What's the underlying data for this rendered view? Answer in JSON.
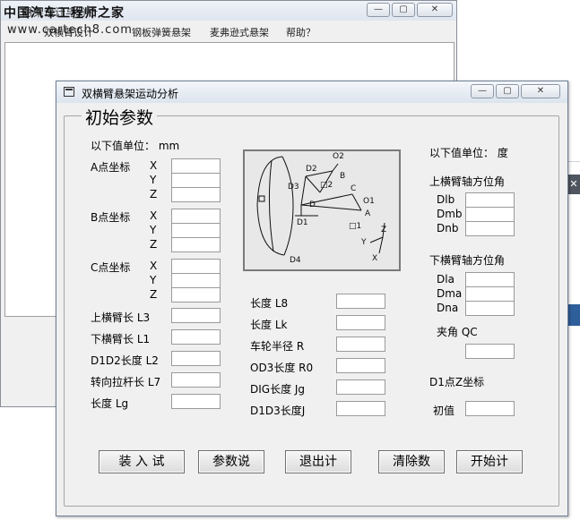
{
  "main_window": {
    "logo": "中国汽车工程师之家",
    "watermark": "www.cartech8.com",
    "title": "悬架设计与分析",
    "menu": [
      "双横臂设计",
      "钢板弹簧悬架",
      "麦弗逊式悬架",
      "帮助？"
    ]
  },
  "dialog": {
    "title": "双横臂悬架运动分析",
    "group_title": "初始参数",
    "unit_mm": "以下值单位：  mm",
    "unit_deg": "以下值单位：  度",
    "points": [
      {
        "label": "A点坐标",
        "axes": [
          "X",
          "Y",
          "Z"
        ]
      },
      {
        "label": "B点坐标",
        "axes": [
          "X",
          "Y",
          "Z"
        ]
      },
      {
        "label": "C点坐标",
        "axes": [
          "X",
          "Y",
          "Z"
        ]
      }
    ],
    "left_params": [
      "上横臂长 L3",
      "下横臂长  L1",
      "D1D2长度 L2",
      "转向拉杆长 L7",
      "长度   Lg"
    ],
    "mid_params": [
      "长度   L8",
      "长度   Lk",
      "车轮半径   R",
      "OD3长度 R0",
      "DIG长度 Jg",
      "D1D3长度J"
    ],
    "upper_arm_title": "上横臂轴方位角",
    "upper_angles": [
      "Dlb",
      "Dmb",
      "Dnb"
    ],
    "lower_arm_title": "下横臂轴方位角",
    "lower_angles": [
      "Dla",
      "Dma",
      "Dna"
    ],
    "angle_qc": "夹角 QC",
    "d1_z_title": "D1点Z坐标",
    "d1_z_initial": "初值",
    "buttons": [
      "装 入 试",
      "参数说",
      "退出计",
      "清除数",
      "开始计"
    ],
    "diagram_labels": {
      "o2": "O2",
      "d2": "D2",
      "b": "B",
      "d3": "D3",
      "q2": "□2",
      "c": "C",
      "o1": "O1",
      "d": "D",
      "a": "A",
      "d1": "D1",
      "q1": "□1",
      "z": "Z",
      "y": "Y",
      "x": "X",
      "d4": "D4",
      "sq": "□"
    }
  },
  "window_controls": {
    "minimize": "—",
    "maximize": "▢",
    "close": "✕"
  }
}
